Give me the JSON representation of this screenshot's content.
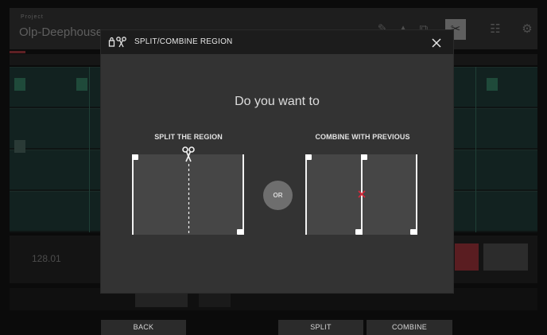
{
  "background": {
    "project_caption": "Project",
    "project_name": "Olp-Deephouse",
    "bpm": "128.01"
  },
  "dialog": {
    "title": "SPLIT/COMBINE REGION",
    "title_icon": "scissors-icon",
    "close_icon": "close-icon",
    "prompt": "Do you want to",
    "split": {
      "label": "SPLIT THE REGION",
      "icon": "scissors-icon"
    },
    "or_label": "OR",
    "combine": {
      "label": "COMBINE WITH PREVIOUS",
      "icon": "cross-icon"
    },
    "accent_color": "#d8283a"
  },
  "softkeys": {
    "back": "BACK",
    "split": "SPLIT",
    "combine": "COMBINE"
  }
}
